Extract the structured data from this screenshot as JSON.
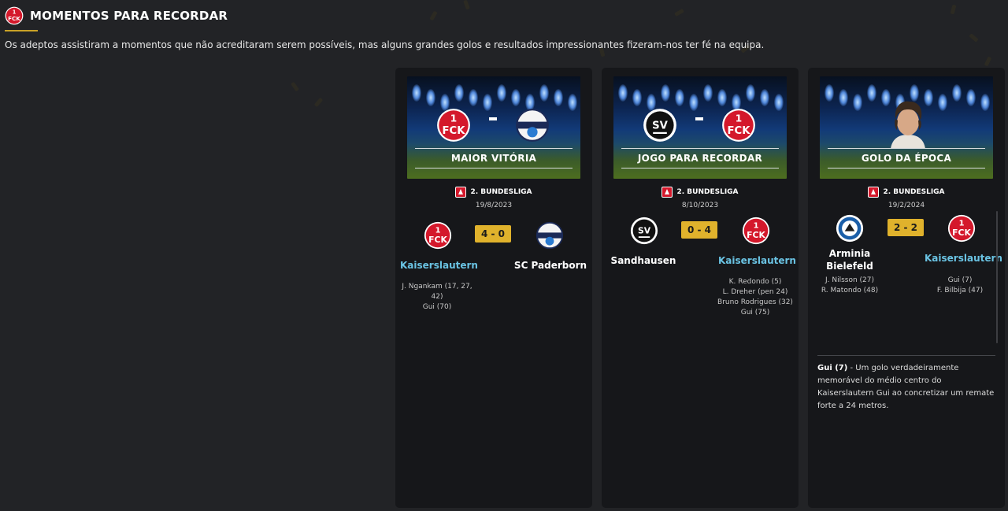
{
  "header": {
    "title": "MOMENTOS PARA RECORDAR",
    "subtitle": "Os adeptos assistiram a momentos que não acreditaram serem possíveis, mas alguns grandes golos e resultados impressionantes fizeram-nos ter fé na equipa."
  },
  "colors": {
    "accent": "#c9a227",
    "score_box": "#e0b22c",
    "highlight_team": "#6ac3e3",
    "card_bg": "#16171a",
    "page_bg": "#222326"
  },
  "cards": [
    {
      "banner_title": "MAIOR VITÓRIA",
      "league": "2. BUNDESLIGA",
      "date": "19/8/2023",
      "home_team": "Kaiserslautern",
      "away_team": "SC Paderborn",
      "score": "4 - 0",
      "home_scorers": [
        "J. Ngankam (17, 27,",
        "42)",
        "Gui (70)"
      ],
      "away_scorers": []
    },
    {
      "banner_title": "JOGO PARA RECORDAR",
      "league": "2. BUNDESLIGA",
      "date": "8/10/2023",
      "home_team": "Sandhausen",
      "away_team": "Kaiserslautern",
      "score": "0 - 4",
      "home_scorers": [],
      "away_scorers": [
        "K. Redondo (5)",
        "L. Dreher (pen 24)",
        "Bruno Rodrigues (32)",
        "Gui (75)"
      ]
    },
    {
      "banner_title": "GOLO DA ÉPOCA",
      "league": "2. BUNDESLIGA",
      "date": "19/2/2024",
      "home_team_line1": "Arminia",
      "home_team_line2": "Bielefeld",
      "away_team": "Kaiserslautern",
      "score": "2 - 2",
      "home_scorers": [
        "J. Nilsson (27)",
        "R. Matondo (48)"
      ],
      "away_scorers": [
        "Gui (7)",
        "F. Bilbija (47)"
      ],
      "goal_scorer": "Gui (7)",
      "goal_description": " - Um golo verdadeiramente memorável do médio centro do Kaiserslautern Gui ao concretizar um remate forte a 24 metros."
    }
  ]
}
